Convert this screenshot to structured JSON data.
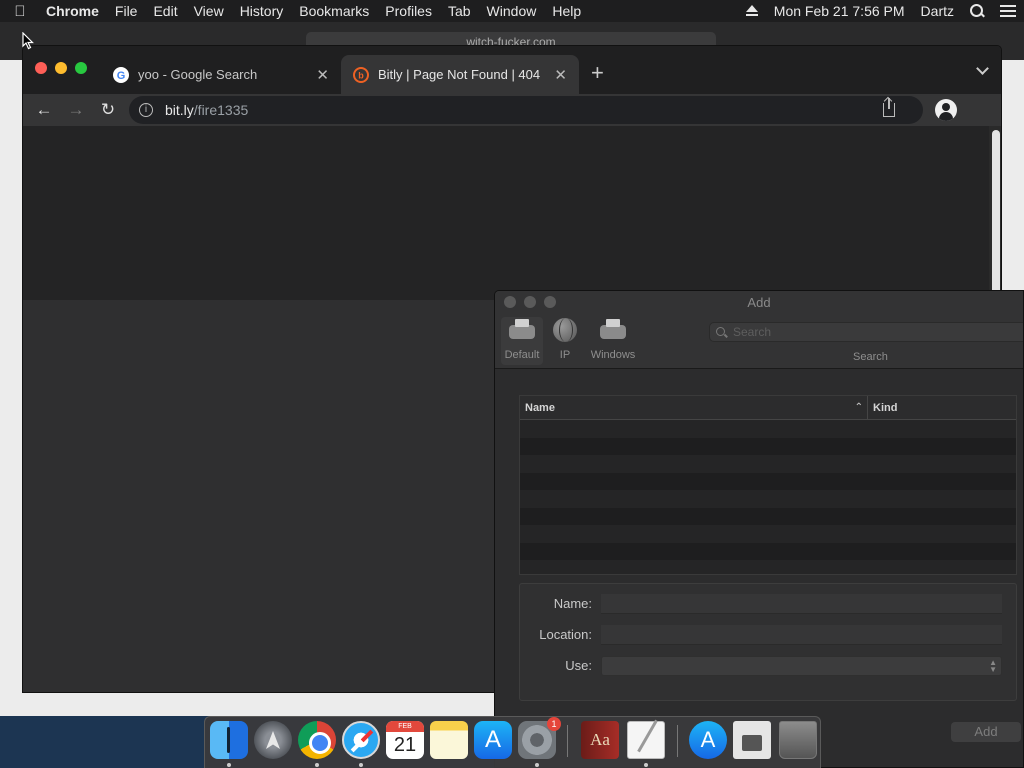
{
  "menubar": {
    "app_name": "Chrome",
    "items": [
      "File",
      "Edit",
      "View",
      "History",
      "Bookmarks",
      "Profiles",
      "Tab",
      "Window",
      "Help"
    ],
    "datetime": "Mon Feb 21  7:56 PM",
    "user": "Dartz"
  },
  "background_window": {
    "url": "witch-fucker.com"
  },
  "chrome": {
    "tabs": [
      {
        "title": "yoo - Google Search",
        "active": false
      },
      {
        "title": "Bitly | Page Not Found | 404",
        "active": true
      }
    ],
    "address": {
      "host": "bit.ly",
      "path": "/fire1335"
    }
  },
  "dialog": {
    "title": "Add",
    "toolbar": [
      "Default",
      "IP",
      "Windows"
    ],
    "search_placeholder": "Search",
    "search_label": "Search",
    "columns": [
      "Name",
      "Kind"
    ],
    "form": {
      "name_label": "Name:",
      "location_label": "Location:",
      "use_label": "Use:"
    },
    "add_button": "Add"
  },
  "dock": {
    "calendar_month": "FEB",
    "calendar_day": "21",
    "prefs_badge": "1",
    "appstore_glyph": "A",
    "dictionary_glyph": "Aa",
    "downloads_glyph": "A"
  }
}
